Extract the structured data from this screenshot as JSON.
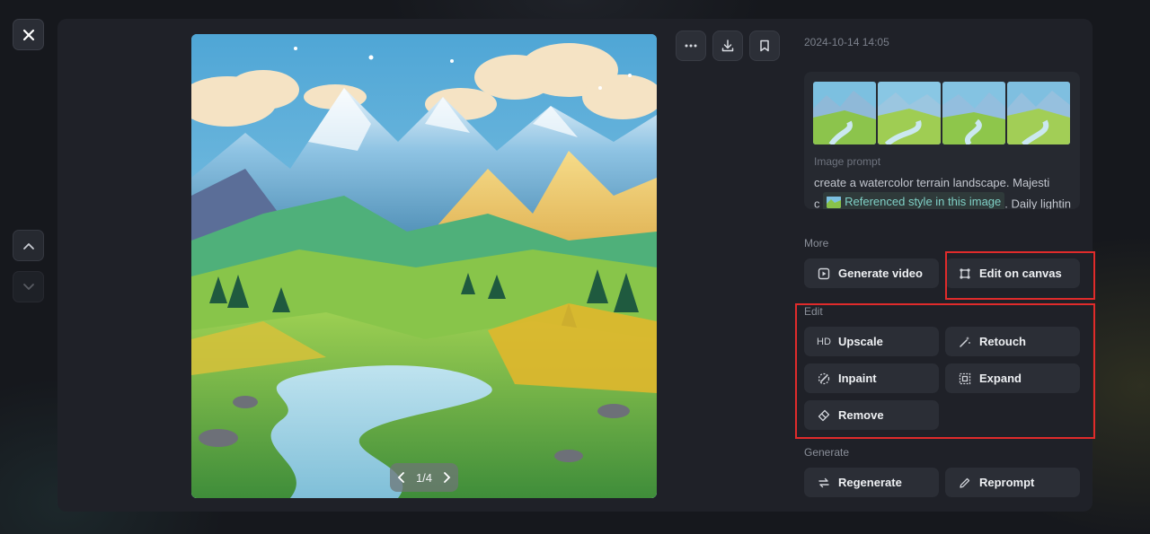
{
  "window": {
    "close_icon": "close-icon"
  },
  "navigation": {
    "up_icon": "chevron-up-icon",
    "down_icon": "chevron-down-icon"
  },
  "toolbar": {
    "more_icon": "more-horizontal-icon",
    "download_icon": "download-icon",
    "bookmark_icon": "bookmark-icon"
  },
  "viewer": {
    "pager_text": "1/4",
    "prev_icon": "chevron-left-icon",
    "next_icon": "chevron-right-icon"
  },
  "details": {
    "timestamp": "2024-10-14 14:05",
    "prompt_label": "Image prompt",
    "prompt_line1": "create a watercolor terrain landscape. Majesti",
    "prompt_line2_prefix": "c",
    "reference_chip": "Referenced style in this image",
    "prompt_line2_suffix": ". Daily lightin"
  },
  "sections": {
    "more": {
      "label": "More",
      "generate_video": "Generate video",
      "edit_on_canvas": "Edit on canvas"
    },
    "edit": {
      "label": "Edit",
      "upscale": "Upscale",
      "upscale_badge": "HD",
      "retouch": "Retouch",
      "inpaint": "Inpaint",
      "expand": "Expand",
      "remove": "Remove"
    },
    "generate": {
      "label": "Generate",
      "regenerate": "Regenerate",
      "reprompt": "Reprompt"
    }
  },
  "colors": {
    "accent_highlight": "#e02b2b",
    "panel_bg": "#1f2128",
    "button_bg": "#2b2e36",
    "chip_text": "#7fd0c6"
  }
}
